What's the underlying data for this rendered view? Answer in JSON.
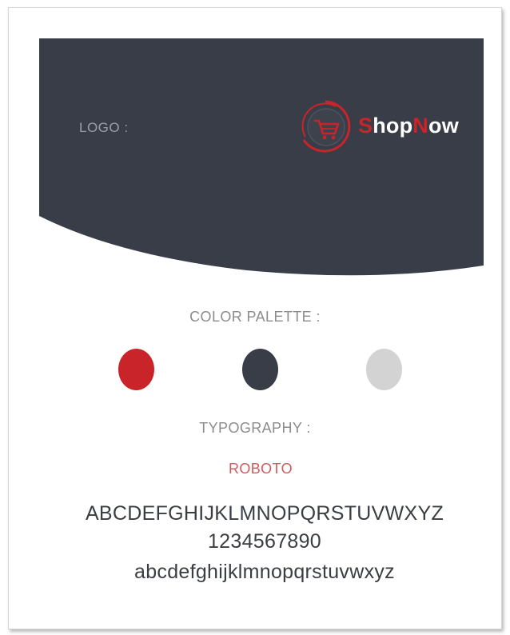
{
  "logo": {
    "label": "LOGO :",
    "brand_first": "S",
    "brand_mid1": "hop",
    "brand_accent2": "N",
    "brand_last": "ow",
    "icon": "shopping-cart-icon"
  },
  "palette": {
    "title": "COLOR PALETTE :",
    "colors": [
      "#c8242a",
      "#383d48",
      "#d3d3d3"
    ]
  },
  "typography": {
    "title": "TYPOGRAPHY :",
    "font_name": "ROBOTO",
    "uppercase": "ABCDEFGHIJKLMNOPQRSTUVWXYZ",
    "digits": "1234567890",
    "lowercase": "abcdefghijklmnopqrstuvwxyz"
  },
  "theme": {
    "header_bg": "#383d48",
    "accent": "#c8242a"
  }
}
